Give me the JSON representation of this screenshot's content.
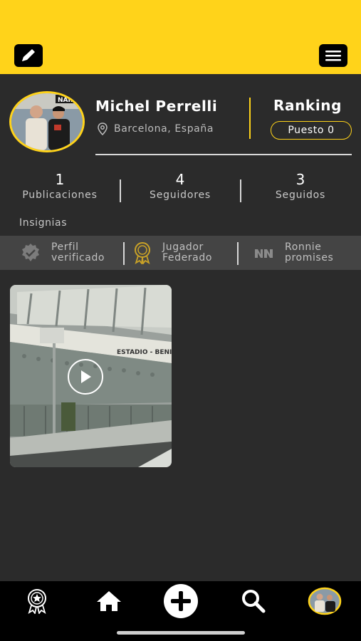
{
  "profile": {
    "name": "Michel Perrelli",
    "location": "Barcelona, España",
    "ranking_title": "Ranking",
    "ranking_position": "Puesto 0"
  },
  "stats": [
    {
      "value": "1",
      "label": "Publicaciones"
    },
    {
      "value": "4",
      "label": "Seguidores"
    },
    {
      "value": "3",
      "label": "Seguidos"
    }
  ],
  "insignias": {
    "title": "Insignias",
    "items": [
      {
        "line1": "Perfil",
        "line2": "verificado",
        "icon": "verified-check-icon"
      },
      {
        "line1": "Jugador",
        "line2": "Federado",
        "icon": "medal-icon"
      },
      {
        "line1": "Ronnie",
        "line2": "promises",
        "icon": "ronnie-logo-icon"
      }
    ]
  },
  "avatar_sign": "NAIL",
  "post_sign": "ESTADIO - BENI",
  "colors": {
    "accent": "#ffd31a",
    "background": "#2b2b2b",
    "nav": "#000000",
    "badge_strip": "#444444"
  },
  "nav": {
    "items": [
      "ranking-medal-icon",
      "home-icon",
      "add-icon",
      "search-icon",
      "profile-avatar"
    ]
  }
}
